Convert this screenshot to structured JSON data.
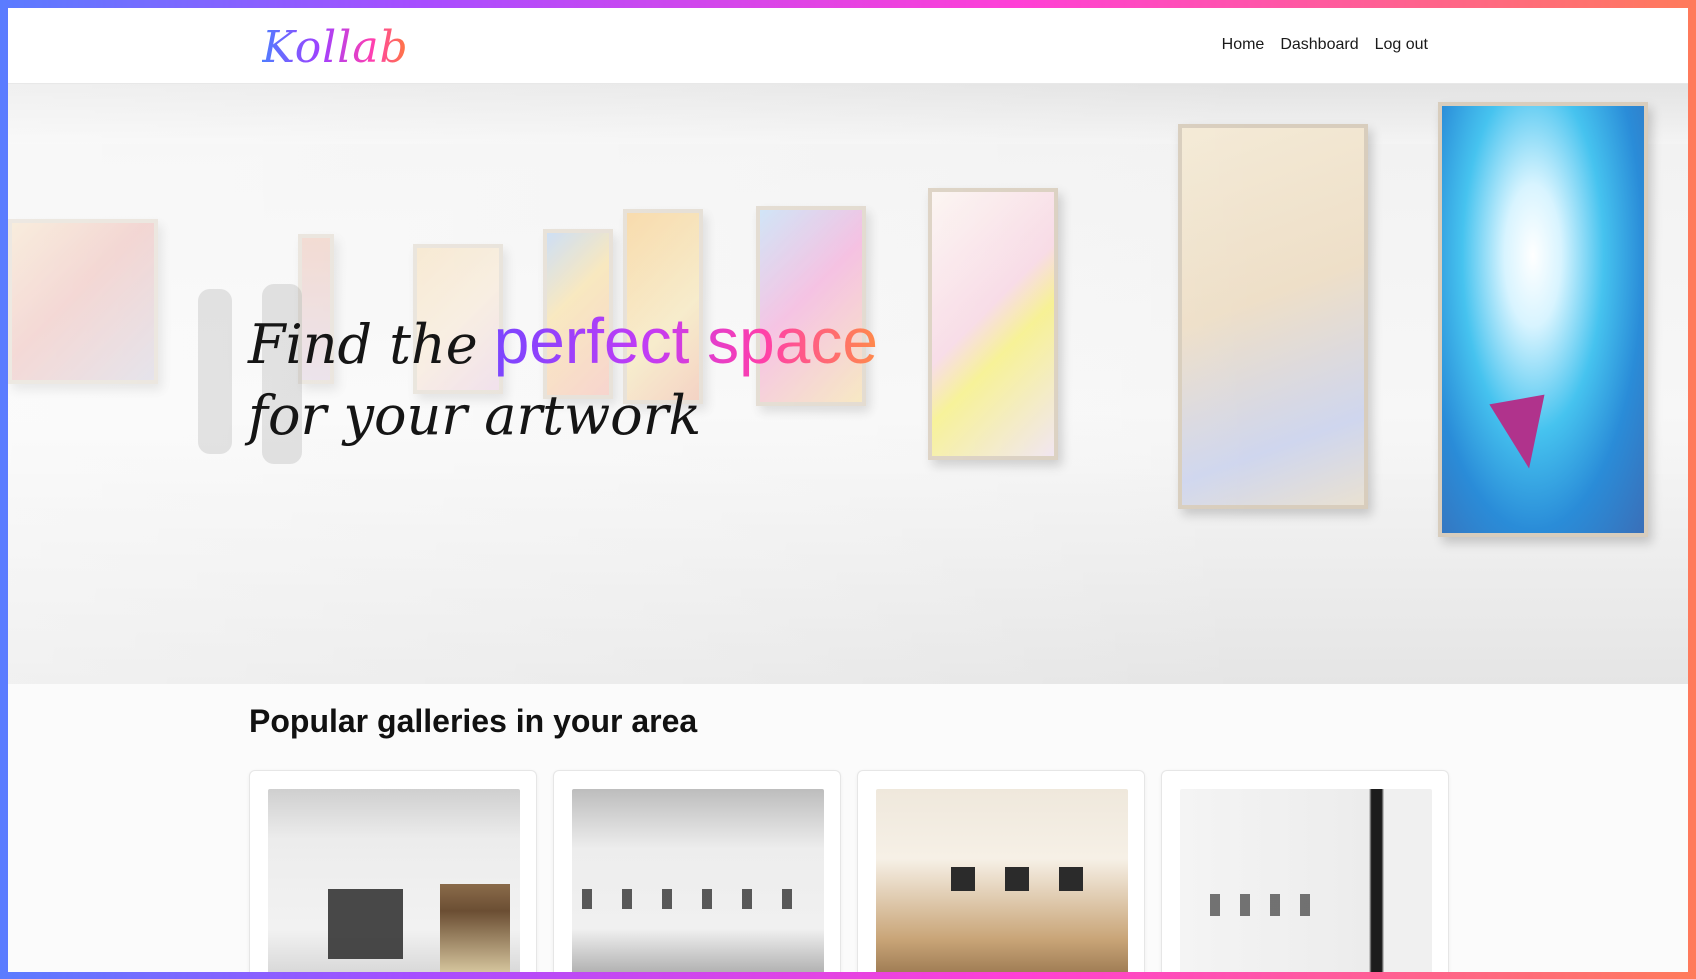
{
  "brand": {
    "logo": "Kollab"
  },
  "nav": {
    "links": [
      {
        "label": "Home"
      },
      {
        "label": "Dashboard"
      },
      {
        "label": "Log out"
      }
    ]
  },
  "hero": {
    "line1_prefix": "Find the",
    "line1_highlight": "perfect space",
    "line2": "for your artwork"
  },
  "popular": {
    "title": "Popular galleries in your area"
  },
  "colors": {
    "frame_gradient": [
      "#5a7cff",
      "#a84dff",
      "#ff3fd6",
      "#ff7b5a"
    ],
    "highlight_gradient": [
      "#7a45ff",
      "#c23cf5",
      "#ff3faa",
      "#ff8a4a"
    ],
    "text": "#111111"
  }
}
